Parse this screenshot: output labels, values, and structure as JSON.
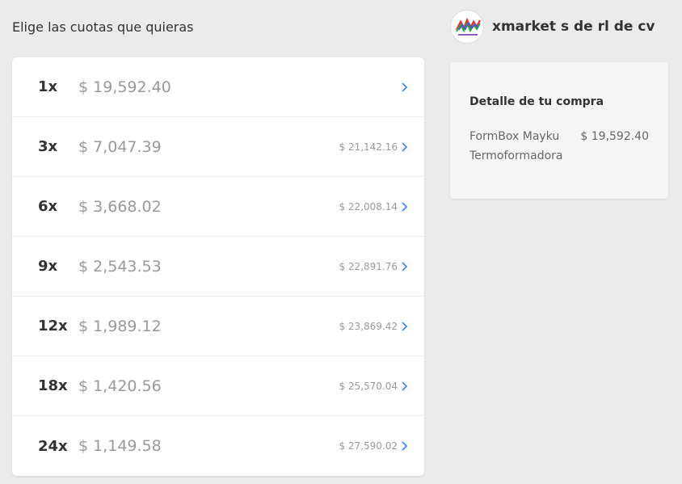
{
  "page_title": "Elige las cuotas que quieras",
  "installments": [
    {
      "count": "1x",
      "amount": "$ 19,592.40",
      "total": ""
    },
    {
      "count": "3x",
      "amount": "$ 7,047.39",
      "total": "$ 21,142.16"
    },
    {
      "count": "6x",
      "amount": "$ 3,668.02",
      "total": "$ 22,008.14"
    },
    {
      "count": "9x",
      "amount": "$ 2,543.53",
      "total": "$ 22,891.76"
    },
    {
      "count": "12x",
      "amount": "$ 1,989.12",
      "total": "$ 23,869.42"
    },
    {
      "count": "18x",
      "amount": "$ 1,420.56",
      "total": "$ 25,570.04"
    },
    {
      "count": "24x",
      "amount": "$ 1,149.58",
      "total": "$ 27,590.02"
    }
  ],
  "seller": {
    "name": "xmarket s de rl de cv",
    "logo_icon": "xmarket-logo"
  },
  "summary": {
    "title": "Detalle de tu compra",
    "product_name": "FormBox Mayku Termoformadora",
    "product_price": "$ 19,592.40"
  },
  "colors": {
    "background": "#ebebeb",
    "card": "#ffffff",
    "chevron": "#3483fa",
    "primary_text": "#333333",
    "muted_text": "#999999"
  }
}
